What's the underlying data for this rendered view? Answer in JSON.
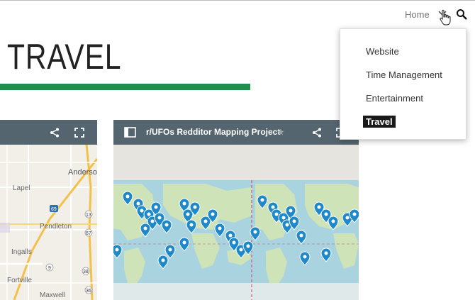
{
  "header": {
    "home_label": "Home",
    "chevron_icon": "chevron-down-icon",
    "search_icon": "search-icon",
    "cursor_icon": "hand-pointer-icon"
  },
  "page": {
    "title": "TRAVEL",
    "accent_color": "#1e8e4a"
  },
  "dropdown": {
    "items": [
      {
        "label": "Website"
      },
      {
        "label": "Time Management"
      },
      {
        "label": "Entertainment"
      },
      {
        "label": "Travel",
        "active": true
      }
    ]
  },
  "cards": {
    "left": {
      "share_icon": "share-icon",
      "fullscreen_icon": "fullscreen-icon",
      "map_labels": [
        "Anderson",
        "Lapel",
        "Pendleton",
        "Ingalls",
        "Fortville",
        "Maxwell",
        "69",
        "9",
        "13",
        "67",
        "38",
        "36"
      ]
    },
    "right": {
      "title": "r/UFOs Redditor Mapping Project",
      "panel_icon": "sidebar-panel-icon",
      "star_icon": "star-icon",
      "share_icon": "share-icon",
      "fullscreen_icon": "fullscreen-icon"
    }
  }
}
